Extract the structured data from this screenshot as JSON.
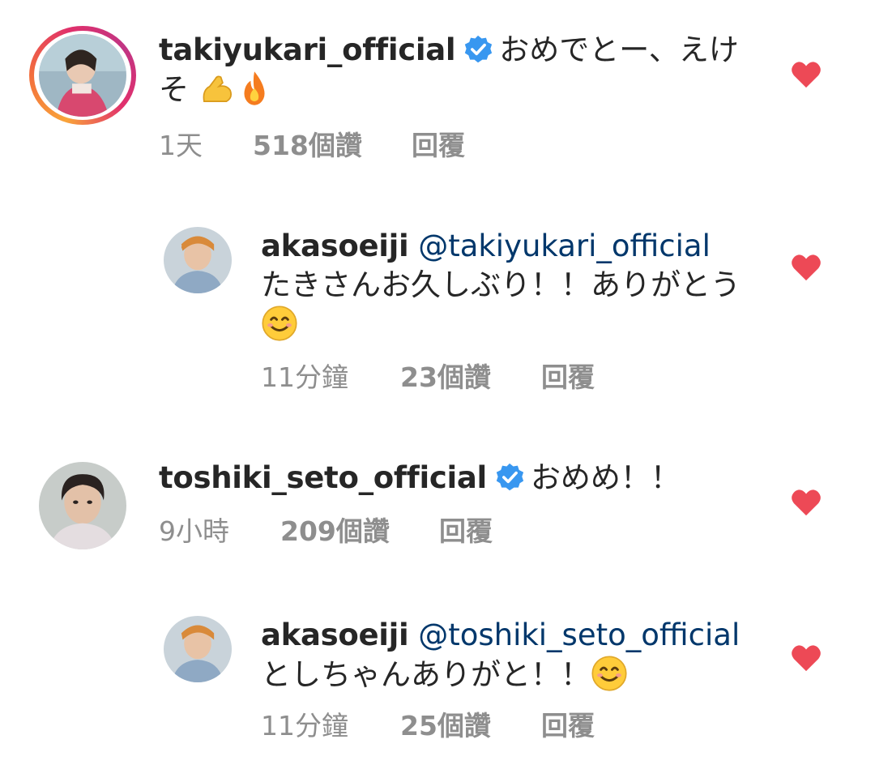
{
  "comments": [
    {
      "username": "takiyukari_official",
      "verified": true,
      "text": "おめでとー、えけそ",
      "emojis": [
        "flexed-biceps",
        "fire"
      ],
      "time": "1天",
      "likes": "518個讚",
      "reply": "回覆"
    },
    {
      "username": "akasoeiji",
      "mention": "@takiyukari_official",
      "text": "たきさんお久しぶり！！ありがとう",
      "emojis": [
        "smiling-face"
      ],
      "time": "11分鐘",
      "likes": "23個讚",
      "reply": "回覆"
    },
    {
      "username": "toshiki_seto_official",
      "verified": true,
      "text": "おめめ！！",
      "time": "9小時",
      "likes": "209個讚",
      "reply": "回覆"
    },
    {
      "username": "akasoeiji",
      "mention": "@toshiki_seto_official",
      "text": "としちゃんありがと！！",
      "emojis": [
        "smiling-face"
      ],
      "time": "11分鐘",
      "likes": "25個讚",
      "reply": "回覆"
    }
  ],
  "colors": {
    "heart": "#ed4956",
    "verified": "#3897f0",
    "mention": "#00376b",
    "meta": "#8e8e8e",
    "text": "#262626"
  },
  "icons": {
    "like": "heart-icon",
    "verified": "verified-badge-icon"
  }
}
